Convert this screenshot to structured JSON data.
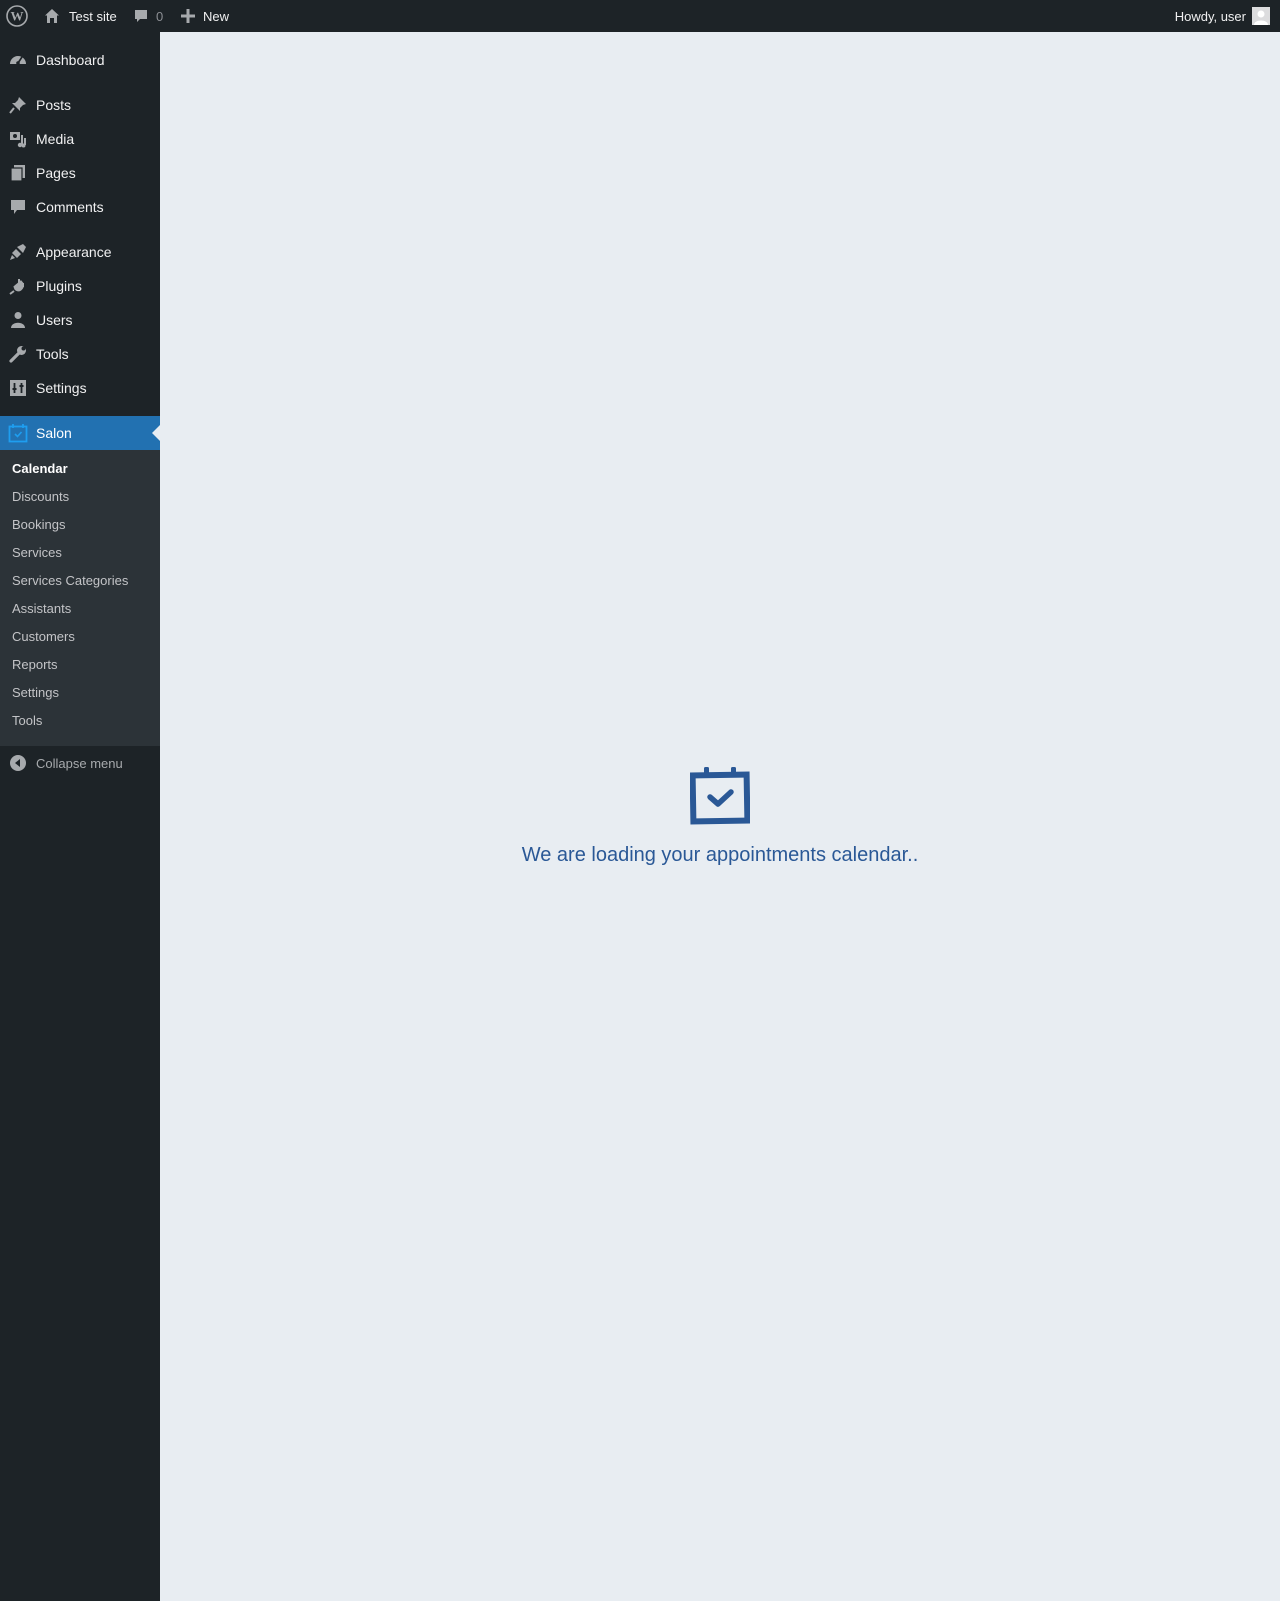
{
  "adminbar": {
    "site_name": "Test site",
    "comments_count": "0",
    "new_label": "New",
    "howdy": "Howdy, user"
  },
  "sidebar": {
    "items": [
      {
        "label": "Dashboard",
        "icon": "dashboard-icon"
      },
      {
        "label": "Posts",
        "icon": "pin-icon"
      },
      {
        "label": "Media",
        "icon": "media-icon"
      },
      {
        "label": "Pages",
        "icon": "pages-icon"
      },
      {
        "label": "Comments",
        "icon": "comment-icon"
      },
      {
        "label": "Appearance",
        "icon": "brush-icon"
      },
      {
        "label": "Plugins",
        "icon": "plugin-icon"
      },
      {
        "label": "Users",
        "icon": "user-icon"
      },
      {
        "label": "Tools",
        "icon": "wrench-icon"
      },
      {
        "label": "Settings",
        "icon": "settings-icon"
      },
      {
        "label": "Salon",
        "icon": "calendar-icon"
      }
    ],
    "submenu": [
      "Calendar",
      "Discounts",
      "Bookings",
      "Services",
      "Services Categories",
      "Assistants",
      "Customers",
      "Reports",
      "Settings",
      "Tools"
    ],
    "collapse_label": "Collapse menu"
  },
  "main": {
    "loading_text": "We are loading your appointments calendar.."
  },
  "colors": {
    "adminbar_bg": "#1d2327",
    "accent": "#2271b1",
    "loader_text": "#2a5896",
    "content_bg": "#e8edf2"
  }
}
